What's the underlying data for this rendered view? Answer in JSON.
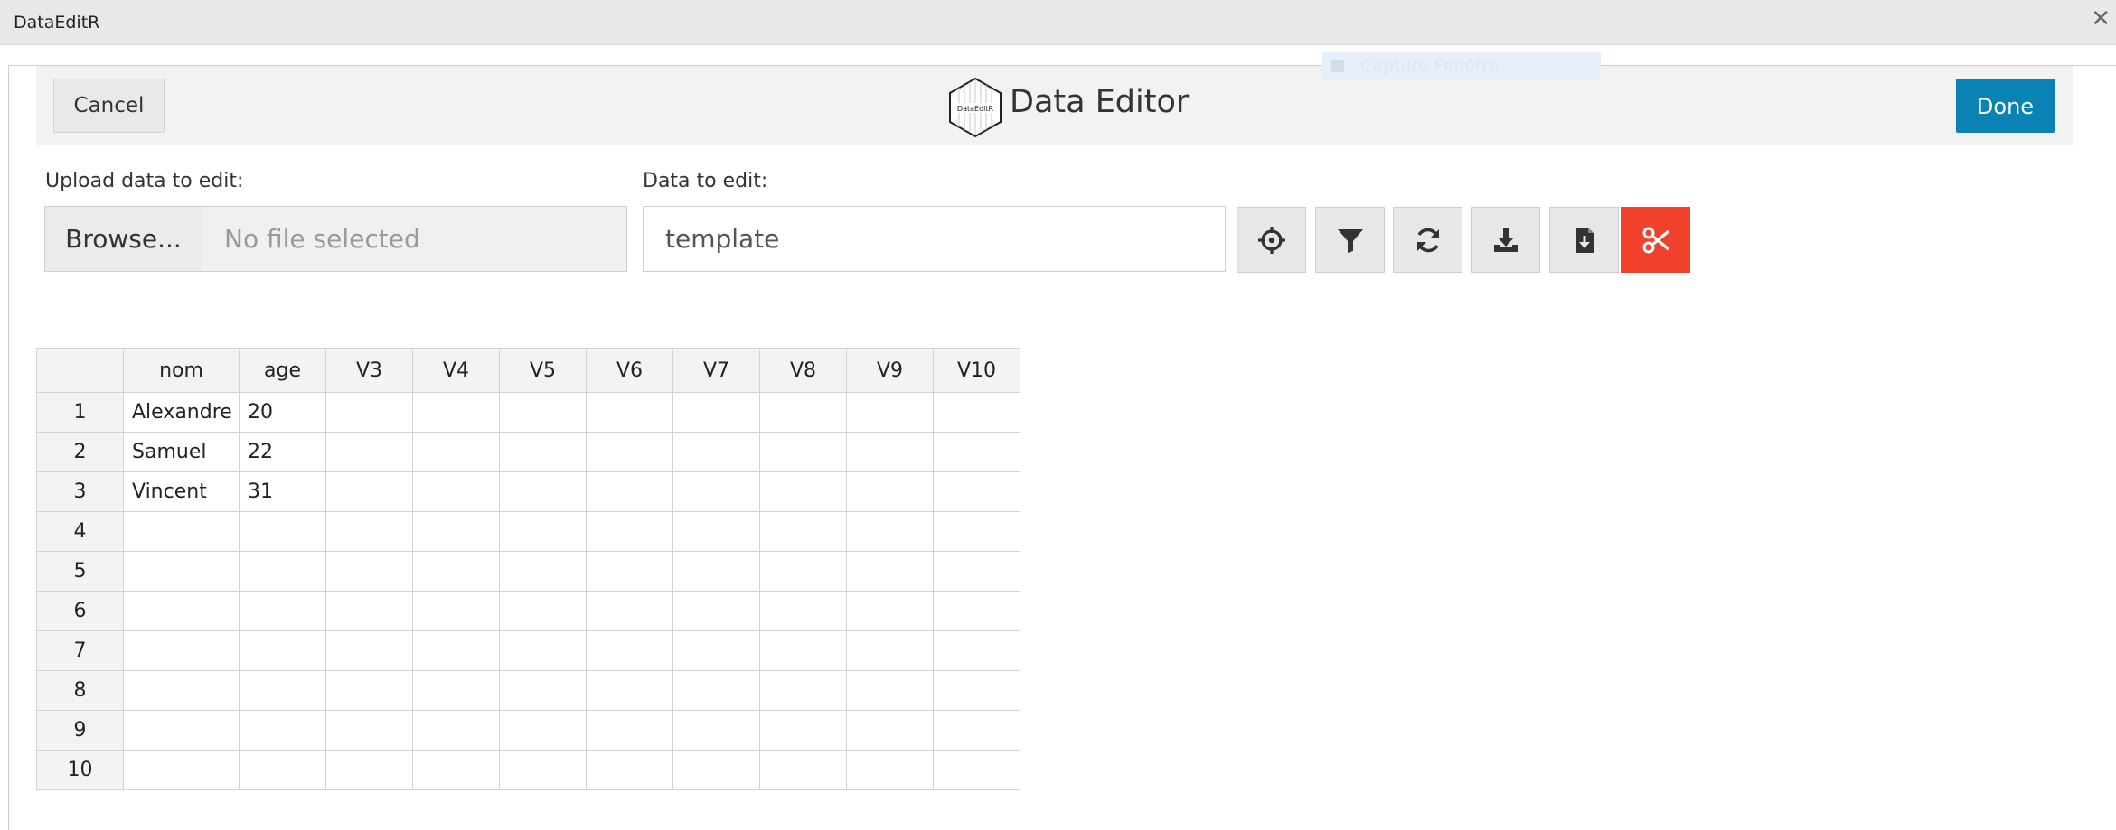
{
  "window": {
    "title": "DataEditR",
    "close_icon": "close-icon",
    "ghost_tooltip": "Capture Fenêtre"
  },
  "toolbar": {
    "cancel_label": "Cancel",
    "done_label": "Done",
    "app_title": "Data Editor",
    "logo_text": "DataEditR"
  },
  "upload": {
    "label": "Upload data to edit:",
    "browse_label": "Browse...",
    "placeholder": "No file selected"
  },
  "data_select": {
    "label": "Data to edit:",
    "value": "template"
  },
  "tools": [
    {
      "name": "select-icon",
      "color": "#333333"
    },
    {
      "name": "filter-icon",
      "color": "#333333"
    },
    {
      "name": "sync-icon",
      "color": "#333333"
    },
    {
      "name": "download-icon",
      "color": "#333333"
    },
    {
      "name": "file-export-icon",
      "color": "#333333"
    },
    {
      "name": "cut-icon",
      "color": "#ffffff",
      "background": "#f1402b"
    }
  ],
  "colors": {
    "done_button": "#0a83b4",
    "cut_button": "#f1402b"
  },
  "table": {
    "columns": [
      "nom",
      "age",
      "V3",
      "V4",
      "V5",
      "V6",
      "V7",
      "V8",
      "V9",
      "V10"
    ],
    "rows": [
      {
        "index": "1",
        "cells": [
          "Alexandre",
          "20",
          "",
          "",
          "",
          "",
          "",
          "",
          "",
          ""
        ]
      },
      {
        "index": "2",
        "cells": [
          "Samuel",
          "22",
          "",
          "",
          "",
          "",
          "",
          "",
          "",
          ""
        ]
      },
      {
        "index": "3",
        "cells": [
          "Vincent",
          "31",
          "",
          "",
          "",
          "",
          "",
          "",
          "",
          ""
        ]
      },
      {
        "index": "4",
        "cells": [
          "",
          "",
          "",
          "",
          "",
          "",
          "",
          "",
          "",
          ""
        ]
      },
      {
        "index": "5",
        "cells": [
          "",
          "",
          "",
          "",
          "",
          "",
          "",
          "",
          "",
          ""
        ]
      },
      {
        "index": "6",
        "cells": [
          "",
          "",
          "",
          "",
          "",
          "",
          "",
          "",
          "",
          ""
        ]
      },
      {
        "index": "7",
        "cells": [
          "",
          "",
          "",
          "",
          "",
          "",
          "",
          "",
          "",
          ""
        ]
      },
      {
        "index": "8",
        "cells": [
          "",
          "",
          "",
          "",
          "",
          "",
          "",
          "",
          "",
          ""
        ]
      },
      {
        "index": "9",
        "cells": [
          "",
          "",
          "",
          "",
          "",
          "",
          "",
          "",
          "",
          ""
        ]
      },
      {
        "index": "10",
        "cells": [
          "",
          "",
          "",
          "",
          "",
          "",
          "",
          "",
          "",
          ""
        ]
      }
    ]
  }
}
